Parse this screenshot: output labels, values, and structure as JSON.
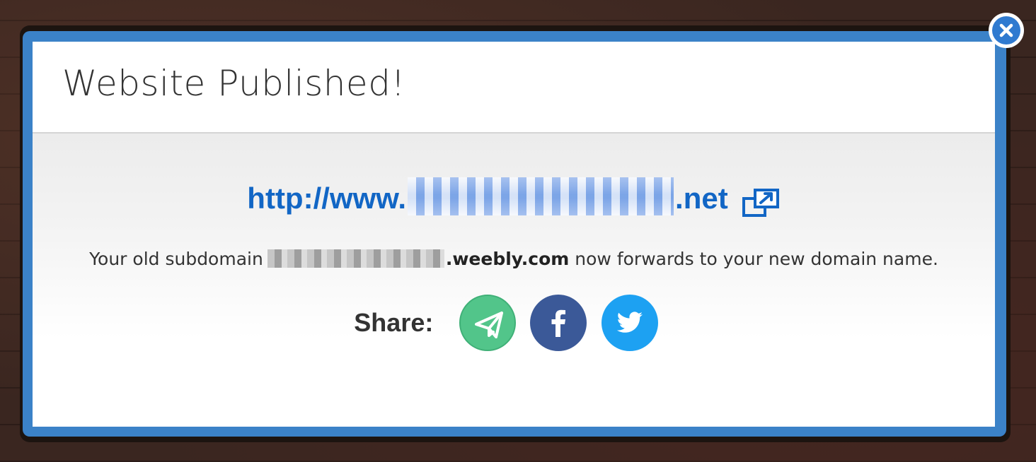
{
  "dialog": {
    "title": "Website Published!",
    "url_prefix": "http://www.",
    "url_suffix": ".net",
    "forward_text_prefix": "Your old subdomain",
    "forward_domain": ".weebly.com",
    "forward_text_suffix": "now forwards to your new domain name.",
    "share_label": "Share:",
    "share_buttons": [
      {
        "network": "email",
        "icon": "paper-plane-icon",
        "color": "#52c58a"
      },
      {
        "network": "facebook",
        "icon": "facebook-icon",
        "color": "#3b5998"
      },
      {
        "network": "twitter",
        "icon": "twitter-icon",
        "color": "#1da1f2"
      }
    ]
  },
  "icons": {
    "close": "close-icon",
    "external_link": "external-link-icon"
  },
  "colors": {
    "frame": "#3b82c8",
    "link": "#1266c5",
    "close_button": "#2f7ad0"
  }
}
